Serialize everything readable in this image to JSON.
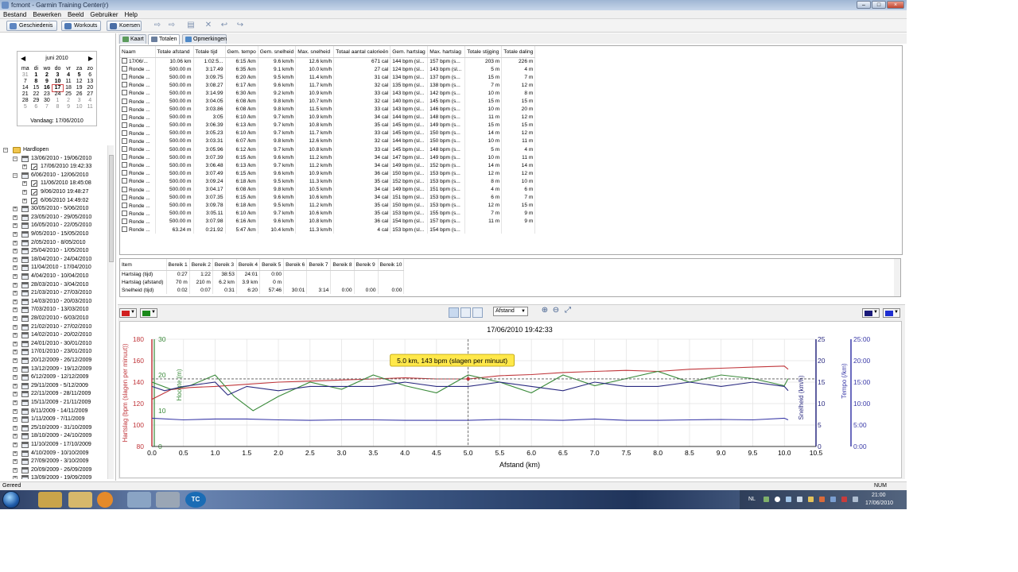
{
  "window": {
    "title": "fcmont - Garmin Training Center(r)"
  },
  "menu": [
    "Bestand",
    "Bewerken",
    "Beeld",
    "Gebruiker",
    "Help"
  ],
  "toolbar": {
    "history": "Geschiedenis",
    "workouts": "Workouts",
    "courses": "Koersen"
  },
  "calendar": {
    "month": "juni 2010",
    "prev": "◀",
    "next": "▶",
    "days_of_week": [
      "ma",
      "di",
      "wo",
      "do",
      "vr",
      "za",
      "zo"
    ],
    "cells": [
      "31",
      "1",
      "2",
      "3",
      "4",
      "5",
      "6",
      "7",
      "8",
      "9",
      "10",
      "11",
      "12",
      "13",
      "14",
      "15",
      "16",
      "17",
      "18",
      "19",
      "20",
      "21",
      "22",
      "23",
      "24",
      "25",
      "26",
      "27",
      "28",
      "29",
      "30",
      "1",
      "2",
      "3",
      "4",
      "5",
      "6",
      "7",
      "8",
      "9",
      "10",
      "11"
    ],
    "today_label": "Vandaag: 17/06/2010"
  },
  "tree": {
    "root": "Hardlopen",
    "items": [
      {
        "label": "13/06/2010 - 19/06/2010",
        "kind": "week",
        "level": 1,
        "exp": "-"
      },
      {
        "label": "17/06/2010 19:42:33",
        "kind": "act",
        "level": 2,
        "exp": "+"
      },
      {
        "label": "6/06/2010 - 12/06/2010",
        "kind": "week",
        "level": 1,
        "exp": "-"
      },
      {
        "label": "11/06/2010 18:45:08",
        "kind": "act",
        "level": 2,
        "exp": "+"
      },
      {
        "label": "9/06/2010 19:48:27",
        "kind": "act",
        "level": 2,
        "exp": "+"
      },
      {
        "label": "6/06/2010 14:49:02",
        "kind": "act",
        "level": 2,
        "exp": "+"
      },
      {
        "label": "30/05/2010 - 5/06/2010",
        "kind": "week",
        "level": 1,
        "exp": "+"
      },
      {
        "label": "23/05/2010 - 29/05/2010",
        "kind": "week",
        "level": 1,
        "exp": "+"
      },
      {
        "label": "16/05/2010 - 22/05/2010",
        "kind": "week",
        "level": 1,
        "exp": "+"
      },
      {
        "label": "9/05/2010 - 15/05/2010",
        "kind": "week",
        "level": 1,
        "exp": "+"
      },
      {
        "label": "2/05/2010 - 8/05/2010",
        "kind": "week",
        "level": 1,
        "exp": "+"
      },
      {
        "label": "25/04/2010 - 1/05/2010",
        "kind": "week",
        "level": 1,
        "exp": "+"
      },
      {
        "label": "18/04/2010 - 24/04/2010",
        "kind": "week",
        "level": 1,
        "exp": "+"
      },
      {
        "label": "11/04/2010 - 17/04/2010",
        "kind": "week",
        "level": 1,
        "exp": "+"
      },
      {
        "label": "4/04/2010 - 10/04/2010",
        "kind": "week",
        "level": 1,
        "exp": "+"
      },
      {
        "label": "28/03/2010 - 3/04/2010",
        "kind": "week",
        "level": 1,
        "exp": "+"
      },
      {
        "label": "21/03/2010 - 27/03/2010",
        "kind": "week",
        "level": 1,
        "exp": "+"
      },
      {
        "label": "14/03/2010 - 20/03/2010",
        "kind": "week",
        "level": 1,
        "exp": "+"
      },
      {
        "label": "7/03/2010 - 13/03/2010",
        "kind": "week",
        "level": 1,
        "exp": "+"
      },
      {
        "label": "28/02/2010 - 6/03/2010",
        "kind": "week",
        "level": 1,
        "exp": "+"
      },
      {
        "label": "21/02/2010 - 27/02/2010",
        "kind": "week",
        "level": 1,
        "exp": "+"
      },
      {
        "label": "14/02/2010 - 20/02/2010",
        "kind": "week",
        "level": 1,
        "exp": "+"
      },
      {
        "label": "24/01/2010 - 30/01/2010",
        "kind": "week",
        "level": 1,
        "exp": "+"
      },
      {
        "label": "17/01/2010 - 23/01/2010",
        "kind": "week",
        "level": 1,
        "exp": "+"
      },
      {
        "label": "20/12/2009 - 26/12/2009",
        "kind": "week",
        "level": 1,
        "exp": "+"
      },
      {
        "label": "13/12/2009 - 19/12/2009",
        "kind": "week",
        "level": 1,
        "exp": "+"
      },
      {
        "label": "6/12/2009 - 12/12/2009",
        "kind": "week",
        "level": 1,
        "exp": "+"
      },
      {
        "label": "29/11/2009 - 5/12/2009",
        "kind": "week",
        "level": 1,
        "exp": "+"
      },
      {
        "label": "22/11/2009 - 28/11/2009",
        "kind": "week",
        "level": 1,
        "exp": "+"
      },
      {
        "label": "15/11/2009 - 21/11/2009",
        "kind": "week",
        "level": 1,
        "exp": "+"
      },
      {
        "label": "8/11/2009 - 14/11/2009",
        "kind": "week",
        "level": 1,
        "exp": "+"
      },
      {
        "label": "1/11/2009 - 7/11/2009",
        "kind": "week",
        "level": 1,
        "exp": "+"
      },
      {
        "label": "25/10/2009 - 31/10/2009",
        "kind": "week",
        "level": 1,
        "exp": "+"
      },
      {
        "label": "18/10/2009 - 24/10/2009",
        "kind": "week",
        "level": 1,
        "exp": "+"
      },
      {
        "label": "11/10/2009 - 17/10/2009",
        "kind": "week",
        "level": 1,
        "exp": "+"
      },
      {
        "label": "4/10/2009 - 10/10/2009",
        "kind": "week",
        "level": 1,
        "exp": "+"
      },
      {
        "label": "27/09/2009 - 3/10/2009",
        "kind": "week",
        "level": 1,
        "exp": "+"
      },
      {
        "label": "20/09/2009 - 26/09/2009",
        "kind": "week",
        "level": 1,
        "exp": "+"
      },
      {
        "label": "13/09/2009 - 19/09/2009",
        "kind": "week",
        "level": 1,
        "exp": "+"
      }
    ]
  },
  "tabs": [
    "Kaart",
    "Totalen",
    "Opmerkingen"
  ],
  "laps": {
    "columns": [
      "Naam",
      "Totale afstand",
      "Totale tijd",
      "Gem. tempo",
      "Gem. snelheid",
      "Max. snelheid",
      "Totaal aantal calorieën",
      "Gem. hartslag",
      "Max. hartslag",
      "Totale stijging",
      "Totale daling"
    ],
    "rows": [
      [
        "17/06/...",
        "10.06 km",
        "1:02:5...",
        "6:15 /km",
        "9.6 km/h",
        "12.6 km/h",
        "671 cal",
        "144 bpm (sl...",
        "157 bpm (s...",
        "203 m",
        "226 m"
      ],
      [
        "Ronde ...",
        "500.00 m",
        "3:17.49",
        "6:35 /km",
        "9.1 km/h",
        "10.0 km/h",
        "27 cal",
        "124 bpm (sl...",
        "143 bpm (sl...",
        "5 m",
        "4 m"
      ],
      [
        "Ronde ...",
        "500.00 m",
        "3:09.75",
        "6:20 /km",
        "9.5 km/h",
        "11.4 km/h",
        "31 cal",
        "134 bpm (sl...",
        "137 bpm (s...",
        "15 m",
        "7 m"
      ],
      [
        "Ronde ...",
        "500.00 m",
        "3:08.27",
        "6:17 /km",
        "9.6 km/h",
        "11.7 km/h",
        "32 cal",
        "135 bpm (sl...",
        "138 bpm (s...",
        "7 m",
        "12 m"
      ],
      [
        "Ronde ...",
        "500.00 m",
        "3:14.99",
        "6:30 /km",
        "9.2 km/h",
        "10.9 km/h",
        "33 cal",
        "143 bpm (sl...",
        "142 bpm (s...",
        "10 m",
        "8 m"
      ],
      [
        "Ronde ...",
        "500.00 m",
        "3:04.05",
        "6:08 /km",
        "9.8 km/h",
        "10.7 km/h",
        "32 cal",
        "140 bpm (sl...",
        "145 bpm (s...",
        "15 m",
        "15 m"
      ],
      [
        "Ronde ...",
        "500.00 m",
        "3:03.86",
        "6:08 /km",
        "9.8 km/h",
        "11.5 km/h",
        "33 cal",
        "143 bpm (sl...",
        "146 bpm (s...",
        "10 m",
        "20 m"
      ],
      [
        "Ronde ...",
        "500.00 m",
        "3:05",
        "6:10 /km",
        "9.7 km/h",
        "10.9 km/h",
        "34 cal",
        "144 bpm (sl...",
        "148 bpm (s...",
        "11 m",
        "12 m"
      ],
      [
        "Ronde ...",
        "500.00 m",
        "3:06.39",
        "6:13 /km",
        "9.7 km/h",
        "10.8 km/h",
        "35 cal",
        "145 bpm (sl...",
        "149 bpm (s...",
        "15 m",
        "15 m"
      ],
      [
        "Ronde ...",
        "500.00 m",
        "3:05.23",
        "6:10 /km",
        "9.7 km/h",
        "11.7 km/h",
        "33 cal",
        "145 bpm (sl...",
        "150 bpm (s...",
        "14 m",
        "12 m"
      ],
      [
        "Ronde ...",
        "500.00 m",
        "3:03.31",
        "6:07 /km",
        "9.8 km/h",
        "12.6 km/h",
        "32 cal",
        "144 bpm (sl...",
        "150 bpm (s...",
        "10 m",
        "11 m"
      ],
      [
        "Ronde ...",
        "500.00 m",
        "3:05.96",
        "6:12 /km",
        "9.7 km/h",
        "10.8 km/h",
        "33 cal",
        "145 bpm (sl...",
        "148 bpm (s...",
        "5 m",
        "4 m"
      ],
      [
        "Ronde ...",
        "500.00 m",
        "3:07.39",
        "6:15 /km",
        "9.6 km/h",
        "11.2 km/h",
        "34 cal",
        "147 bpm (sl...",
        "149 bpm (s...",
        "10 m",
        "11 m"
      ],
      [
        "Ronde ...",
        "500.00 m",
        "3:06.48",
        "6:13 /km",
        "9.7 km/h",
        "11.2 km/h",
        "34 cal",
        "149 bpm (sl...",
        "152 bpm (s...",
        "14 m",
        "14 m"
      ],
      [
        "Ronde ...",
        "500.00 m",
        "3:07.49",
        "6:15 /km",
        "9.6 km/h",
        "10.9 km/h",
        "36 cal",
        "150 bpm (sl...",
        "153 bpm (s...",
        "12 m",
        "12 m"
      ],
      [
        "Ronde ...",
        "500.00 m",
        "3:09.24",
        "6:18 /km",
        "9.5 km/h",
        "11.3 km/h",
        "35 cal",
        "152 bpm (sl...",
        "153 bpm (s...",
        "8 m",
        "10 m"
      ],
      [
        "Ronde ...",
        "500.00 m",
        "3:04.17",
        "6:08 /km",
        "9.8 km/h",
        "10.5 km/h",
        "34 cal",
        "149 bpm (sl...",
        "151 bpm (s...",
        "4 m",
        "6 m"
      ],
      [
        "Ronde ...",
        "500.00 m",
        "3:07.35",
        "6:15 /km",
        "9.6 km/h",
        "10.6 km/h",
        "34 cal",
        "151 bpm (sl...",
        "153 bpm (s...",
        "6 m",
        "7 m"
      ],
      [
        "Ronde ...",
        "500.00 m",
        "3:09.78",
        "6:18 /km",
        "9.5 km/h",
        "11.2 km/h",
        "35 cal",
        "150 bpm (sl...",
        "153 bpm (s...",
        "12 m",
        "15 m"
      ],
      [
        "Ronde ...",
        "500.00 m",
        "3:05.11",
        "6:10 /km",
        "9.7 km/h",
        "10.6 km/h",
        "35 cal",
        "153 bpm (sl...",
        "155 bpm (s...",
        "7 m",
        "9 m"
      ],
      [
        "Ronde ...",
        "500.00 m",
        "3:07.98",
        "6:16 /km",
        "9.6 km/h",
        "10.8 km/h",
        "36 cal",
        "154 bpm (sl...",
        "157 bpm (s...",
        "11 m",
        "9 m"
      ],
      [
        "Ronde ...",
        "63.24 m",
        "0:21.92",
        "5:47 /km",
        "10.4 km/h",
        "11.3 km/h",
        "4 cal",
        "153 bpm (sl...",
        "154 bpm (s...",
        "",
        ""
      ]
    ]
  },
  "zones": {
    "columns": [
      "Item",
      "Bereik 1",
      "Bereik 2",
      "Bereik 3",
      "Bereik 4",
      "Bereik 5",
      "Bereik 6",
      "Bereik 7",
      "Bereik 8",
      "Bereik 9",
      "Bereik 10"
    ],
    "rows": [
      [
        "Hartslag (tijd)",
        "0:27",
        "1:22",
        "38:53",
        "24:01",
        "0:00",
        "",
        "",
        "",
        "",
        ""
      ],
      [
        "Hartslag (afstand)",
        "70 m",
        "210 m",
        "6.2 km",
        "3.9 km",
        "0 m",
        "",
        "",
        "",
        "",
        ""
      ],
      [
        "Snelheid (tijd)",
        "0:02",
        "0:07",
        "0:31",
        "6:20",
        "57:46",
        "30:01",
        "3:14",
        "0:00",
        "0:00",
        "0:00"
      ]
    ]
  },
  "chart_controls": {
    "x_axis_select": "Afstand"
  },
  "chart_data": {
    "type": "line",
    "title": "17/06/2010 19:42:33",
    "xlabel": "Afstand (km)",
    "x_ticks": [
      "0.0",
      "0.5",
      "1.0",
      "1.5",
      "2.0",
      "2.5",
      "3.0",
      "3.5",
      "4.0",
      "4.5",
      "5.0",
      "5.5",
      "6.0",
      "6.5",
      "7.0",
      "7.5",
      "8.0",
      "8.5",
      "9.0",
      "9.5",
      "10.0",
      "10.5"
    ],
    "xlim": [
      0,
      10.5
    ],
    "left_axis": {
      "label": "Hartslag (bpm (slagen per minuut))",
      "ticks": [
        "80",
        "100",
        "120",
        "140",
        "160",
        "180"
      ],
      "ylim": [
        80,
        180
      ]
    },
    "left_axis_2": {
      "label": "Hoogte (m)",
      "ticks": [
        "0",
        "10",
        "20",
        "30"
      ],
      "ylim": [
        0,
        30
      ]
    },
    "right_axis_1": {
      "label": "Snelheid (km/h)",
      "ticks": [
        "0",
        "5",
        "10",
        "15",
        "20",
        "25"
      ],
      "ylim": [
        0,
        25
      ]
    },
    "right_axis_2": {
      "label": "Tempo (/km)",
      "ticks": [
        "0:00",
        "5:00",
        "10:00",
        "15:00",
        "20:00",
        "25:00"
      ]
    },
    "tooltip": "5.0 km, 143 bpm (slagen per minuut)",
    "cursor_x": 5.0,
    "dashed_line_y": 143,
    "colors": {
      "heart_rate": "#c0363b",
      "elevation": "#3a8a3a",
      "speed": "#2a2a80",
      "pace": "#3a3aa8"
    },
    "series": [
      {
        "name": "Hartslag",
        "axis": "left",
        "x": [
          0,
          0.3,
          0.6,
          1.0,
          1.5,
          2.0,
          2.5,
          3.0,
          3.5,
          4.0,
          4.5,
          5.0,
          5.5,
          6.0,
          6.5,
          7.0,
          7.5,
          8.0,
          8.5,
          9.0,
          9.5,
          10.0,
          10.06
        ],
        "values": [
          124,
          133,
          135,
          136,
          138,
          140,
          141,
          142,
          143,
          144,
          143,
          143,
          146,
          147,
          149,
          150,
          151,
          150,
          152,
          153,
          154,
          155,
          152
        ]
      },
      {
        "name": "Hoogte",
        "axis": "left2",
        "x": [
          0,
          0.3,
          0.6,
          1.0,
          1.3,
          1.6,
          2.0,
          2.5,
          3.0,
          3.5,
          4.0,
          4.5,
          5.0,
          5.5,
          6.0,
          6.5,
          7.0,
          7.5,
          8.0,
          8.5,
          9.0,
          9.5,
          10.0,
          10.06
        ],
        "values": [
          18,
          16,
          17,
          20,
          14,
          10,
          14,
          18,
          16,
          20,
          17,
          15,
          20,
          18,
          15,
          20,
          17,
          19,
          21,
          18,
          20,
          19,
          17,
          19
        ]
      },
      {
        "name": "Snelheid",
        "axis": "right",
        "x": [
          0,
          0.2,
          0.5,
          1.0,
          1.2,
          1.5,
          2.0,
          2.5,
          3.0,
          3.5,
          4.0,
          4.5,
          5.0,
          5.5,
          6.0,
          6.5,
          7.0,
          7.5,
          8.0,
          8.5,
          9.0,
          9.5,
          10.0,
          10.06
        ],
        "values": [
          14,
          13,
          14,
          15,
          12,
          14,
          13,
          14,
          14,
          14,
          15,
          14,
          14,
          15,
          14,
          13,
          15,
          14,
          14,
          15,
          14,
          15,
          14,
          13
        ]
      },
      {
        "name": "Tempo",
        "axis": "right",
        "x": [
          0,
          0.5,
          1.0,
          1.5,
          2.0,
          2.5,
          3.0,
          3.5,
          4.0,
          4.5,
          5.0,
          5.5,
          6.0,
          6.5,
          7.0,
          7.5,
          8.0,
          8.5,
          9.0,
          9.5,
          10.0,
          10.06
        ],
        "values": [
          6.6,
          6.2,
          6.4,
          6.4,
          6.2,
          6.1,
          6.2,
          6.2,
          6.1,
          6.1,
          6.1,
          6.3,
          6.2,
          6.1,
          6.4,
          6.1,
          6.1,
          6.2,
          6.3,
          6.2,
          6.6,
          6.2
        ]
      }
    ]
  },
  "status": {
    "left": "Gereed",
    "right": "NUM"
  },
  "tray": {
    "lang": "NL",
    "time": "21:00",
    "date": "17/06/2010"
  },
  "taskbar_icons": [
    "explorer-icon",
    "library-icon",
    "media-player-icon",
    "tools-icon",
    "device-icon",
    "tc-icon"
  ],
  "taskbar_tc_label": "TC"
}
